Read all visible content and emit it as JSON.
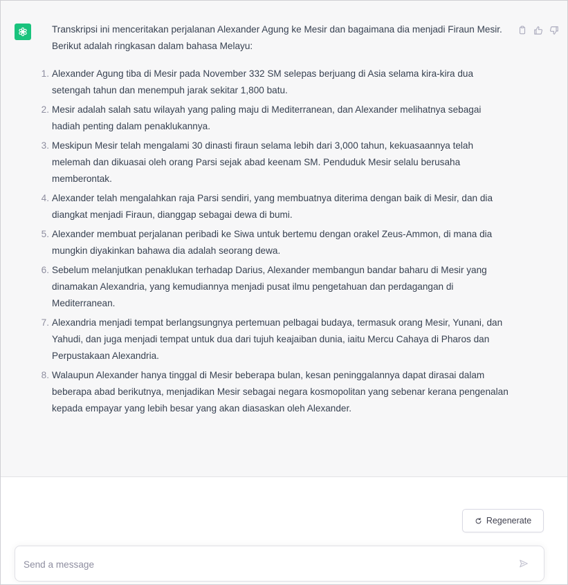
{
  "message": {
    "avatar_icon": "openai-logo-icon",
    "avatar_color": "#19c37d",
    "intro": "Transkripsi ini menceritakan perjalanan Alexander Agung ke Mesir dan bagaimana dia menjadi Firaun Mesir. Berikut adalah ringkasan dalam bahasa Melayu:",
    "items": [
      {
        "num": "1.",
        "text": "Alexander Agung tiba di Mesir pada November 332 SM selepas berjuang di Asia selama kira-kira dua setengah tahun dan menempuh jarak sekitar 1,800 batu."
      },
      {
        "num": "2.",
        "text": "Mesir adalah salah satu wilayah yang paling maju di Mediterranean, dan Alexander melihatnya sebagai hadiah penting dalam penaklukannya."
      },
      {
        "num": "3.",
        "text": "Meskipun Mesir telah mengalami 30 dinasti firaun selama lebih dari 3,000 tahun, kekuasaannya telah melemah dan dikuasai oleh orang Parsi sejak abad keenam SM. Penduduk Mesir selalu berusaha memberontak."
      },
      {
        "num": "4.",
        "text": "Alexander telah mengalahkan raja Parsi sendiri, yang membuatnya diterima dengan baik di Mesir, dan dia diangkat menjadi Firaun, dianggap sebagai dewa di bumi."
      },
      {
        "num": "5.",
        "text": "Alexander membuat perjalanan peribadi ke Siwa untuk bertemu dengan orakel Zeus-Ammon, di mana dia mungkin diyakinkan bahawa dia adalah seorang dewa."
      },
      {
        "num": "6.",
        "text": "Sebelum melanjutkan penaklukan terhadap Darius, Alexander membangun bandar baharu di Mesir yang dinamakan Alexandria, yang kemudiannya menjadi pusat ilmu pengetahuan dan perdagangan di Mediterranean."
      },
      {
        "num": "7.",
        "text": "Alexandria menjadi tempat berlangsungnya pertemuan pelbagai budaya, termasuk orang Mesir, Yunani, dan Yahudi, dan juga menjadi tempat untuk dua dari tujuh keajaiban dunia, iaitu Mercu Cahaya di Pharos dan Perpustakaan Alexandria."
      },
      {
        "num": "8.",
        "text": "Walaupun Alexander hanya tinggal di Mesir beberapa bulan, kesan peninggalannya dapat dirasai dalam beberapa abad berikutnya, menjadikan Mesir sebagai negara kosmopolitan yang sebenar kerana pengenalan kepada empayar yang lebih besar yang akan diasaskan oleh Alexander."
      }
    ],
    "actions": [
      "copy-icon",
      "thumbs-up-icon",
      "thumbs-down-icon"
    ]
  },
  "regenerate": {
    "label": "Regenerate",
    "icon": "refresh-icon"
  },
  "composer": {
    "placeholder": "Send a message",
    "value": "",
    "send_icon": "send-icon"
  },
  "colors": {
    "message_bg": "#f7f7f8",
    "text": "#374151",
    "muted": "#8e8ea0",
    "accent": "#19c37d"
  }
}
